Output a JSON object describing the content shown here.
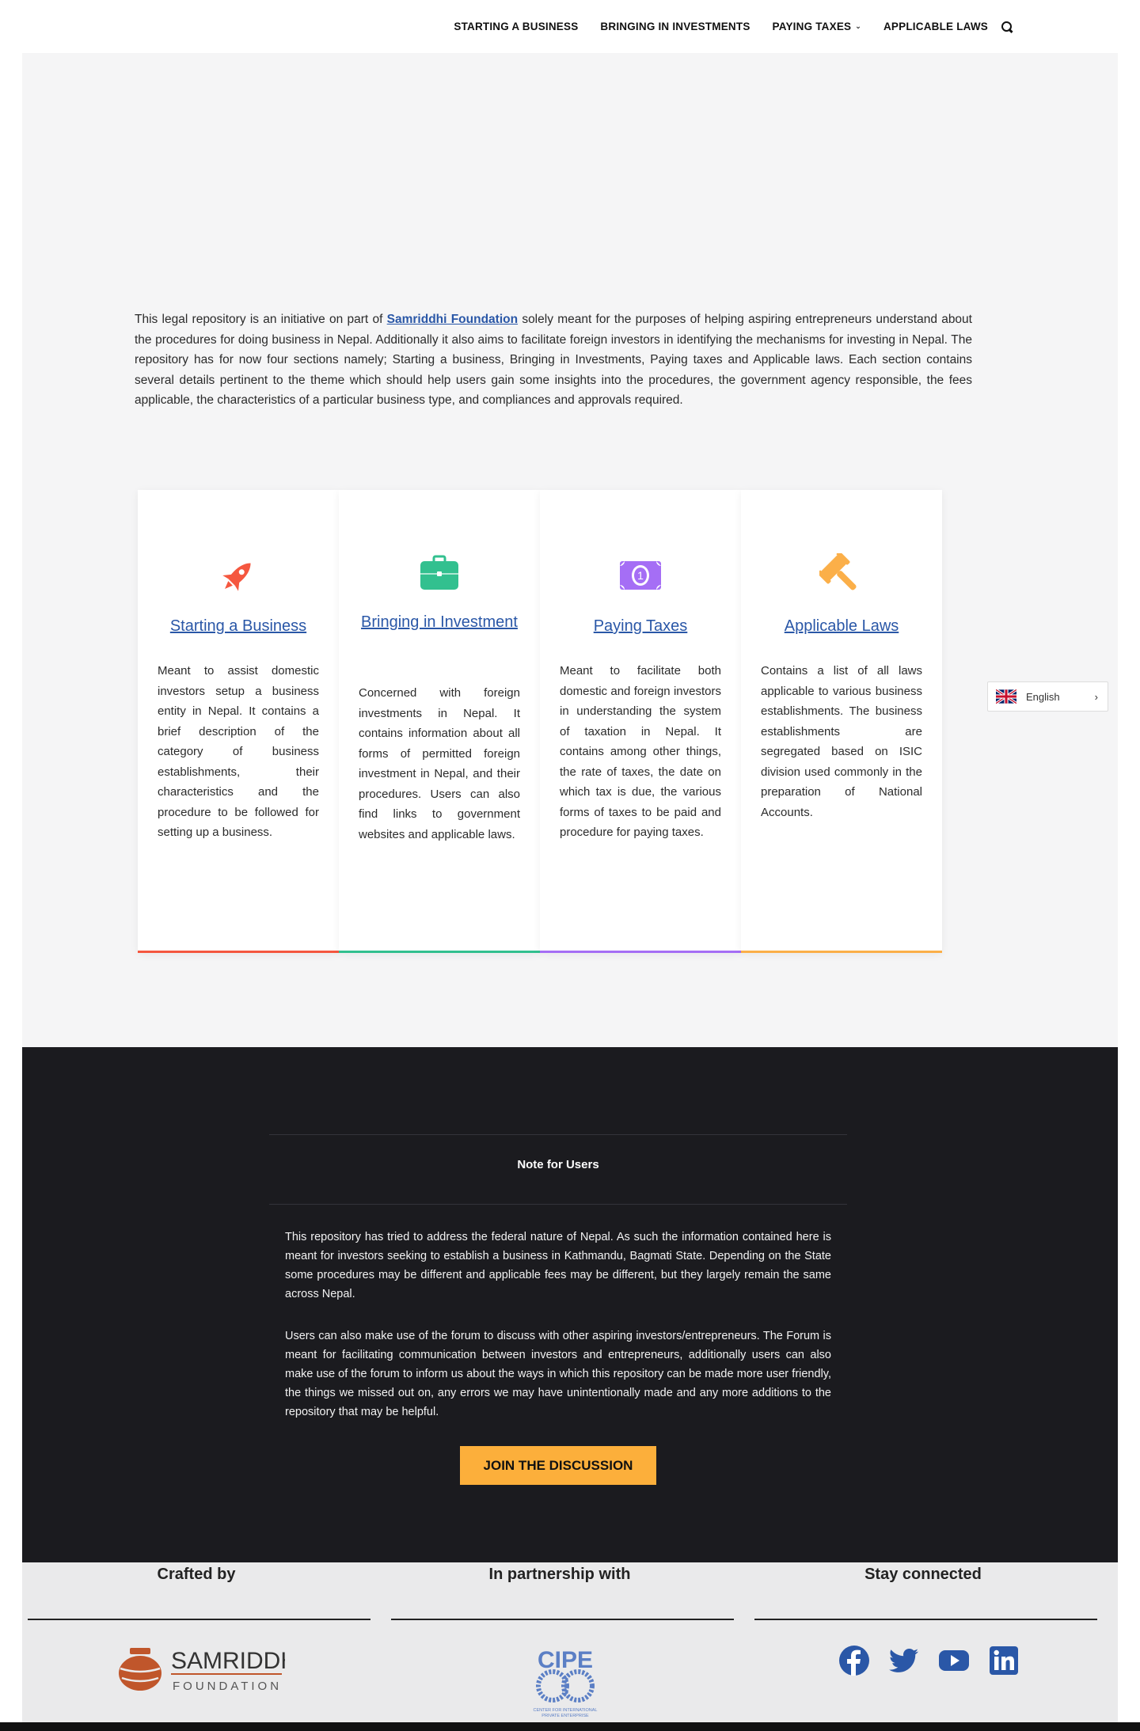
{
  "nav": {
    "items": [
      "STARTING A BUSINESS",
      "BRINGING IN INVESTMENTS",
      "PAYING TAXES",
      "APPLICABLE LAWS"
    ],
    "caret": "⌄"
  },
  "intro": {
    "before": "This legal repository is an initiative on part of ",
    "link": "Samriddhi Foundation",
    "after": " solely meant for the purposes of helping aspiring entrepreneurs understand about the procedures for doing business in Nepal. Additionally it also aims to facilitate foreign investors in identifying the mechanisms for investing in Nepal. The repository has for now four sections namely; Starting a business, Bringing in Investments, Paying taxes and Applicable laws. Each section contains several details pertinent to the theme which should help users gain some insights into the procedures, the government agency responsible, the fees applicable, the characteristics of a particular business type, and compliances and approvals required."
  },
  "cards": [
    {
      "title": "Starting a Business",
      "icon": "rocket-icon",
      "color": "#f5573f",
      "desc": "Meant to assist domestic investors setup a business entity in Nepal. It contains a brief description of the category of business establishments, their characteristics and the procedure to be followed for setting up a business."
    },
    {
      "title": "Bringing in Investment",
      "icon": "briefcase-icon",
      "color": "#32c08f",
      "desc": "Concerned with foreign investments in Nepal. It contains information about all forms of permitted foreign investment in Nepal, and their procedures. Users can also find links to government websites and applicable laws."
    },
    {
      "title": "Paying Taxes",
      "icon": "money-icon",
      "color": "#a56ef5",
      "desc": "Meant to facilitate both domestic and foreign investors in understanding the system of taxation in Nepal. It contains among other things, the rate of taxes, the date on which tax is due, the various forms of taxes to be paid and procedure for paying taxes."
    },
    {
      "title": "Applicable Laws",
      "icon": "gavel-icon",
      "color": "#fbaf49",
      "desc": "Contains a list of all laws applicable to various business establishments. The business establishments are segregated based on ISIC division used commonly in the preparation of National Accounts."
    }
  ],
  "language": {
    "label": "English",
    "chevron": "›"
  },
  "note": {
    "title": "Note for Users",
    "p1": "This repository has tried to address the federal nature of Nepal. As such the information contained here is meant for investors seeking to establish a business in Kathmandu, Bagmati State. Depending on the State some procedures may be different and applicable fees may be different, but they largely remain the same across Nepal.",
    "p2": "Users can also make use of the forum to discuss with other aspiring investors/entrepreneurs. The Forum is meant for facilitating communication between investors and entrepreneurs, additionally users can also make use of the forum to inform us about the ways in which this repository can be made more user friendly, the things we missed out on, any errors we may have unintentionally made and any more additions to the repository that may be helpful.",
    "button": "JOIN THE DISCUSSION"
  },
  "footer": {
    "crafted": "Crafted by",
    "partner": "In partnership with",
    "connected": "Stay connected",
    "samriddhi_name": "SAMRIDDHI",
    "samriddhi_sub": "FOUNDATION",
    "cipe": "CIPE",
    "cipe_sub1": "CENTER FOR INTERNATIONAL",
    "cipe_sub2": "PRIVATE ENTERPRISE",
    "social": [
      "facebook-icon",
      "twitter-icon",
      "youtube-icon",
      "linkedin-icon"
    ],
    "social_color": "#2a57a7",
    "logo_color": "#c0562b"
  }
}
